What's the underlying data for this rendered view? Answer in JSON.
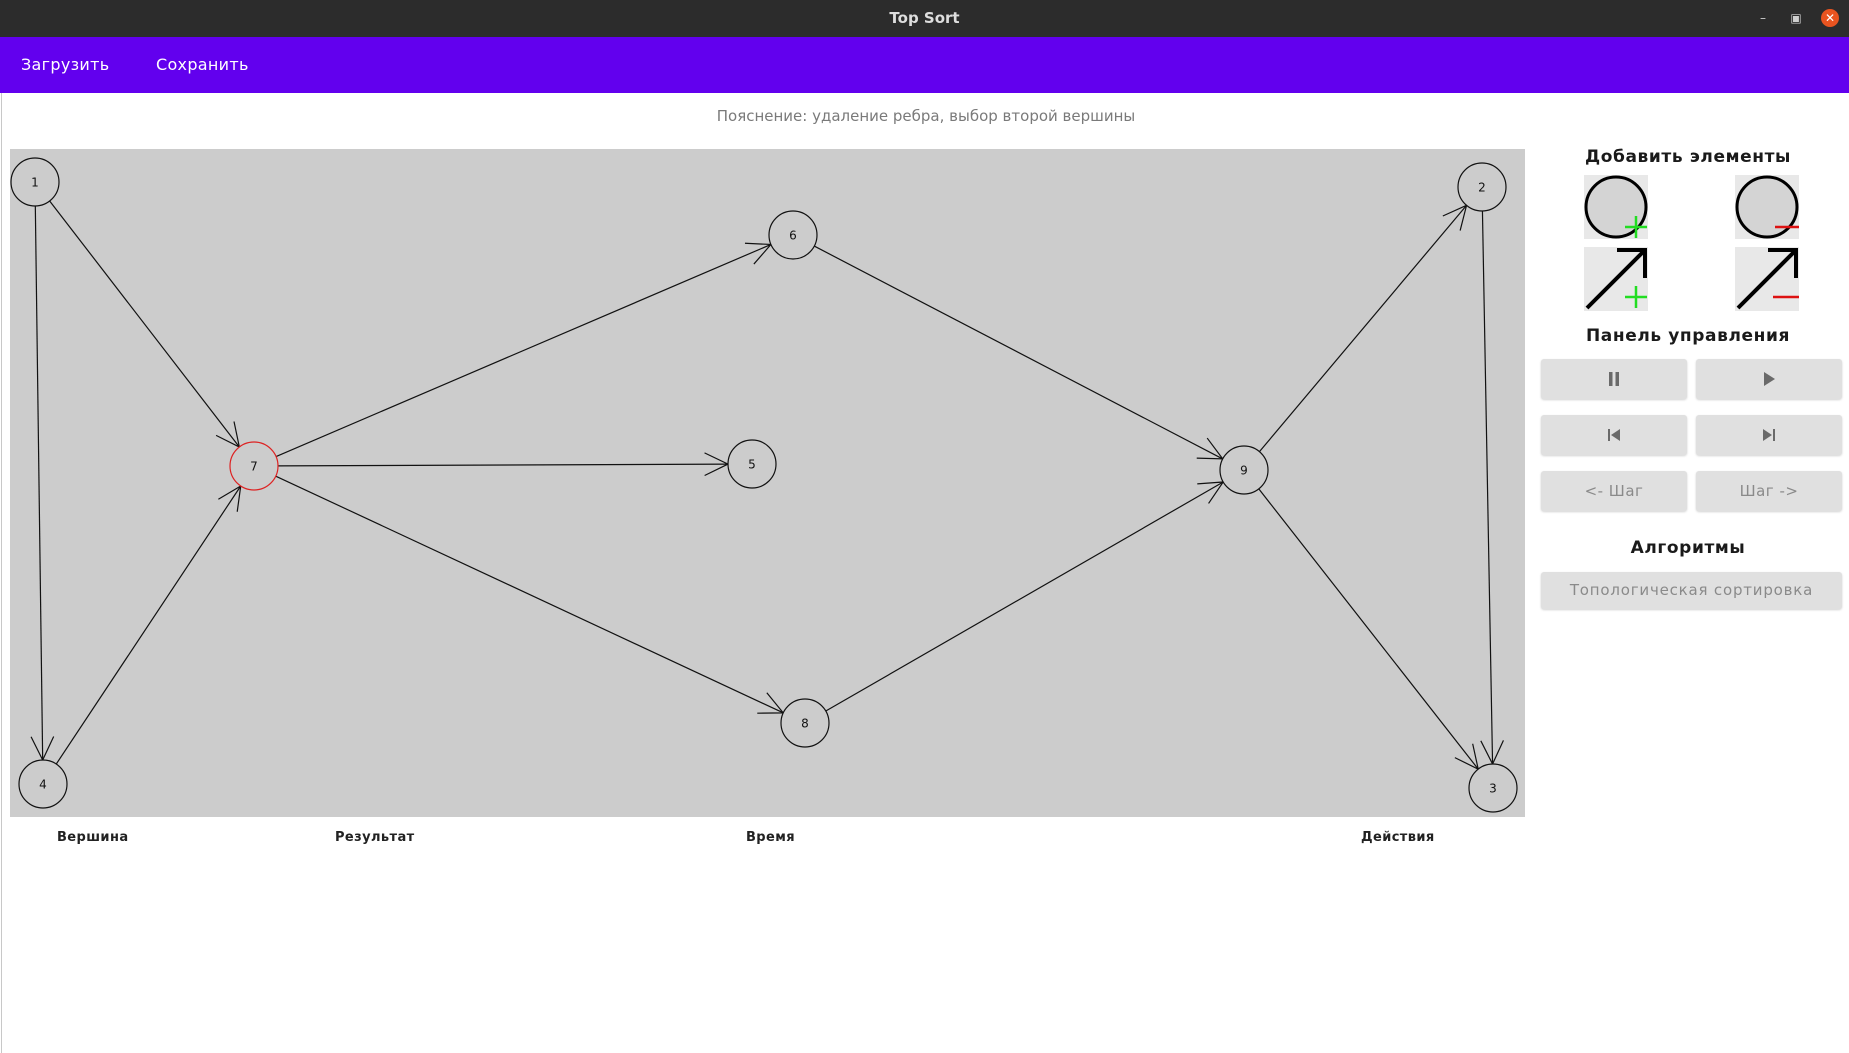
{
  "window": {
    "title": "Top Sort"
  },
  "menu": {
    "load_label": "Загрузить",
    "save_label": "Сохранить"
  },
  "explanation": "Пояснение: удаление ребра, выбор второй вершины",
  "graph": {
    "vertices": [
      {
        "id": "1",
        "highlighted": false
      },
      {
        "id": "2",
        "highlighted": false
      },
      {
        "id": "3",
        "highlighted": false
      },
      {
        "id": "4",
        "highlighted": false
      },
      {
        "id": "5",
        "highlighted": false
      },
      {
        "id": "6",
        "highlighted": false
      },
      {
        "id": "7",
        "highlighted": true
      },
      {
        "id": "8",
        "highlighted": false
      },
      {
        "id": "9",
        "highlighted": false
      }
    ],
    "edges": [
      {
        "from": "1",
        "to": "7"
      },
      {
        "from": "1",
        "to": "4"
      },
      {
        "from": "4",
        "to": "7"
      },
      {
        "from": "7",
        "to": "6"
      },
      {
        "from": "7",
        "to": "5"
      },
      {
        "from": "7",
        "to": "8"
      },
      {
        "from": "6",
        "to": "9"
      },
      {
        "from": "8",
        "to": "9"
      },
      {
        "from": "9",
        "to": "2"
      },
      {
        "from": "9",
        "to": "3"
      },
      {
        "from": "2",
        "to": "3"
      }
    ],
    "colors": {
      "background": "#cccccc",
      "highlight": "#dd2222",
      "normal": "#111111"
    }
  },
  "table_headers": {
    "vertex": "Вершина",
    "result": "Результат",
    "time": "Время",
    "actions": "Действия"
  },
  "sidebar": {
    "add_elements_title": "Добавить элементы",
    "tools": [
      {
        "name": "add-vertex",
        "icon": "circle-plus-icon"
      },
      {
        "name": "remove-vertex",
        "icon": "circle-minus-icon"
      },
      {
        "name": "add-edge",
        "icon": "arrow-plus-icon"
      },
      {
        "name": "remove-edge",
        "icon": "arrow-minus-icon"
      }
    ],
    "control_panel_title": "Панель управления",
    "step_back_label": "<- Шаг",
    "step_forward_label": "Шаг ->",
    "algorithms_title": "Алгоритмы",
    "topsort_label": "Топологическая сортировка"
  },
  "colors": {
    "accent": "#6200ee",
    "titlebar": "#2c2c2c",
    "close": "#e95420",
    "plus": "#22dd22",
    "minus": "#dd1111"
  }
}
